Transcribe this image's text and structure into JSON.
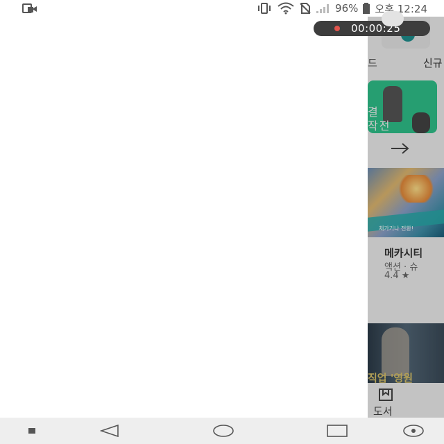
{
  "status_bar": {
    "battery_percent": "96%",
    "time": "오후 12:24"
  },
  "recorder": {
    "elapsed": "00:00:25"
  },
  "background_app": {
    "tabs": [
      "드",
      "신규"
    ],
    "featured_card": {
      "text_line1": "결",
      "text_line2": "작전"
    },
    "banner": {
      "subtitle": "체가기나 전환!"
    },
    "game": {
      "title": "메카시티",
      "genre": "액션 · 슈",
      "rating": "4.4 ★"
    },
    "dark_card": {
      "text": "직업 '영원"
    },
    "bottom_tab": {
      "label": "도서"
    }
  },
  "colors": {
    "recorder_pill": "#3d3d3d",
    "recorder_dot": "#e2554d",
    "featured_card_bg": "#2fc18a",
    "teal_accent": "#1e8f8e",
    "navbar_bg": "#eeeeee"
  },
  "icons": [
    "screen-record-icon",
    "vibrate-icon",
    "wifi-icon",
    "no-sim-icon",
    "signal-icon",
    "battery-icon",
    "arrow-right-icon",
    "book-icon",
    "nav-square-icon",
    "nav-back-icon",
    "nav-home-icon",
    "nav-recents-icon",
    "nav-dot-icon"
  ]
}
